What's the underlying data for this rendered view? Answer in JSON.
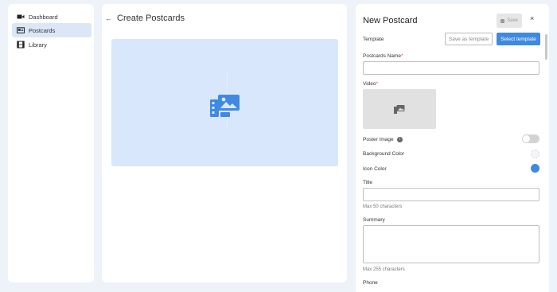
{
  "sidebar": {
    "items": [
      {
        "label": "Dashboard",
        "icon": "video-camera-icon",
        "active": false
      },
      {
        "label": "Postcards",
        "icon": "postcard-icon",
        "active": true
      },
      {
        "label": "Library",
        "icon": "film-library-icon",
        "active": false
      }
    ]
  },
  "main": {
    "back_icon": "arrow-left-icon",
    "title": "Create Postcards",
    "preview_icon": "media-gallery-icon"
  },
  "panel": {
    "title": "New Postcard",
    "save_label": "Save",
    "close_label": "×",
    "template_label": "Template",
    "save_as_template_label": "Save as template",
    "select_template_label": "Select template",
    "name_label": "Postcards Name",
    "required_mark": "*",
    "name_value": "",
    "video_label": "Video",
    "poster_label": "Poster Image",
    "poster_enabled": false,
    "info_glyph": "i",
    "bg_color_label": "Background Color",
    "icon_color_label": "Icon Color",
    "title_label": "Title",
    "title_value": "",
    "title_hint": "Max 50 characters",
    "summary_label": "Summary",
    "summary_value": "",
    "summary_hint": "Max 255 characters",
    "phone_label": "Phone"
  },
  "colors": {
    "accent": "#3f8ae0",
    "background_color_swatch": "#f3f5f8",
    "icon_color_swatch": "#3f8ae0",
    "preview_bg": "#d8e7fb"
  }
}
